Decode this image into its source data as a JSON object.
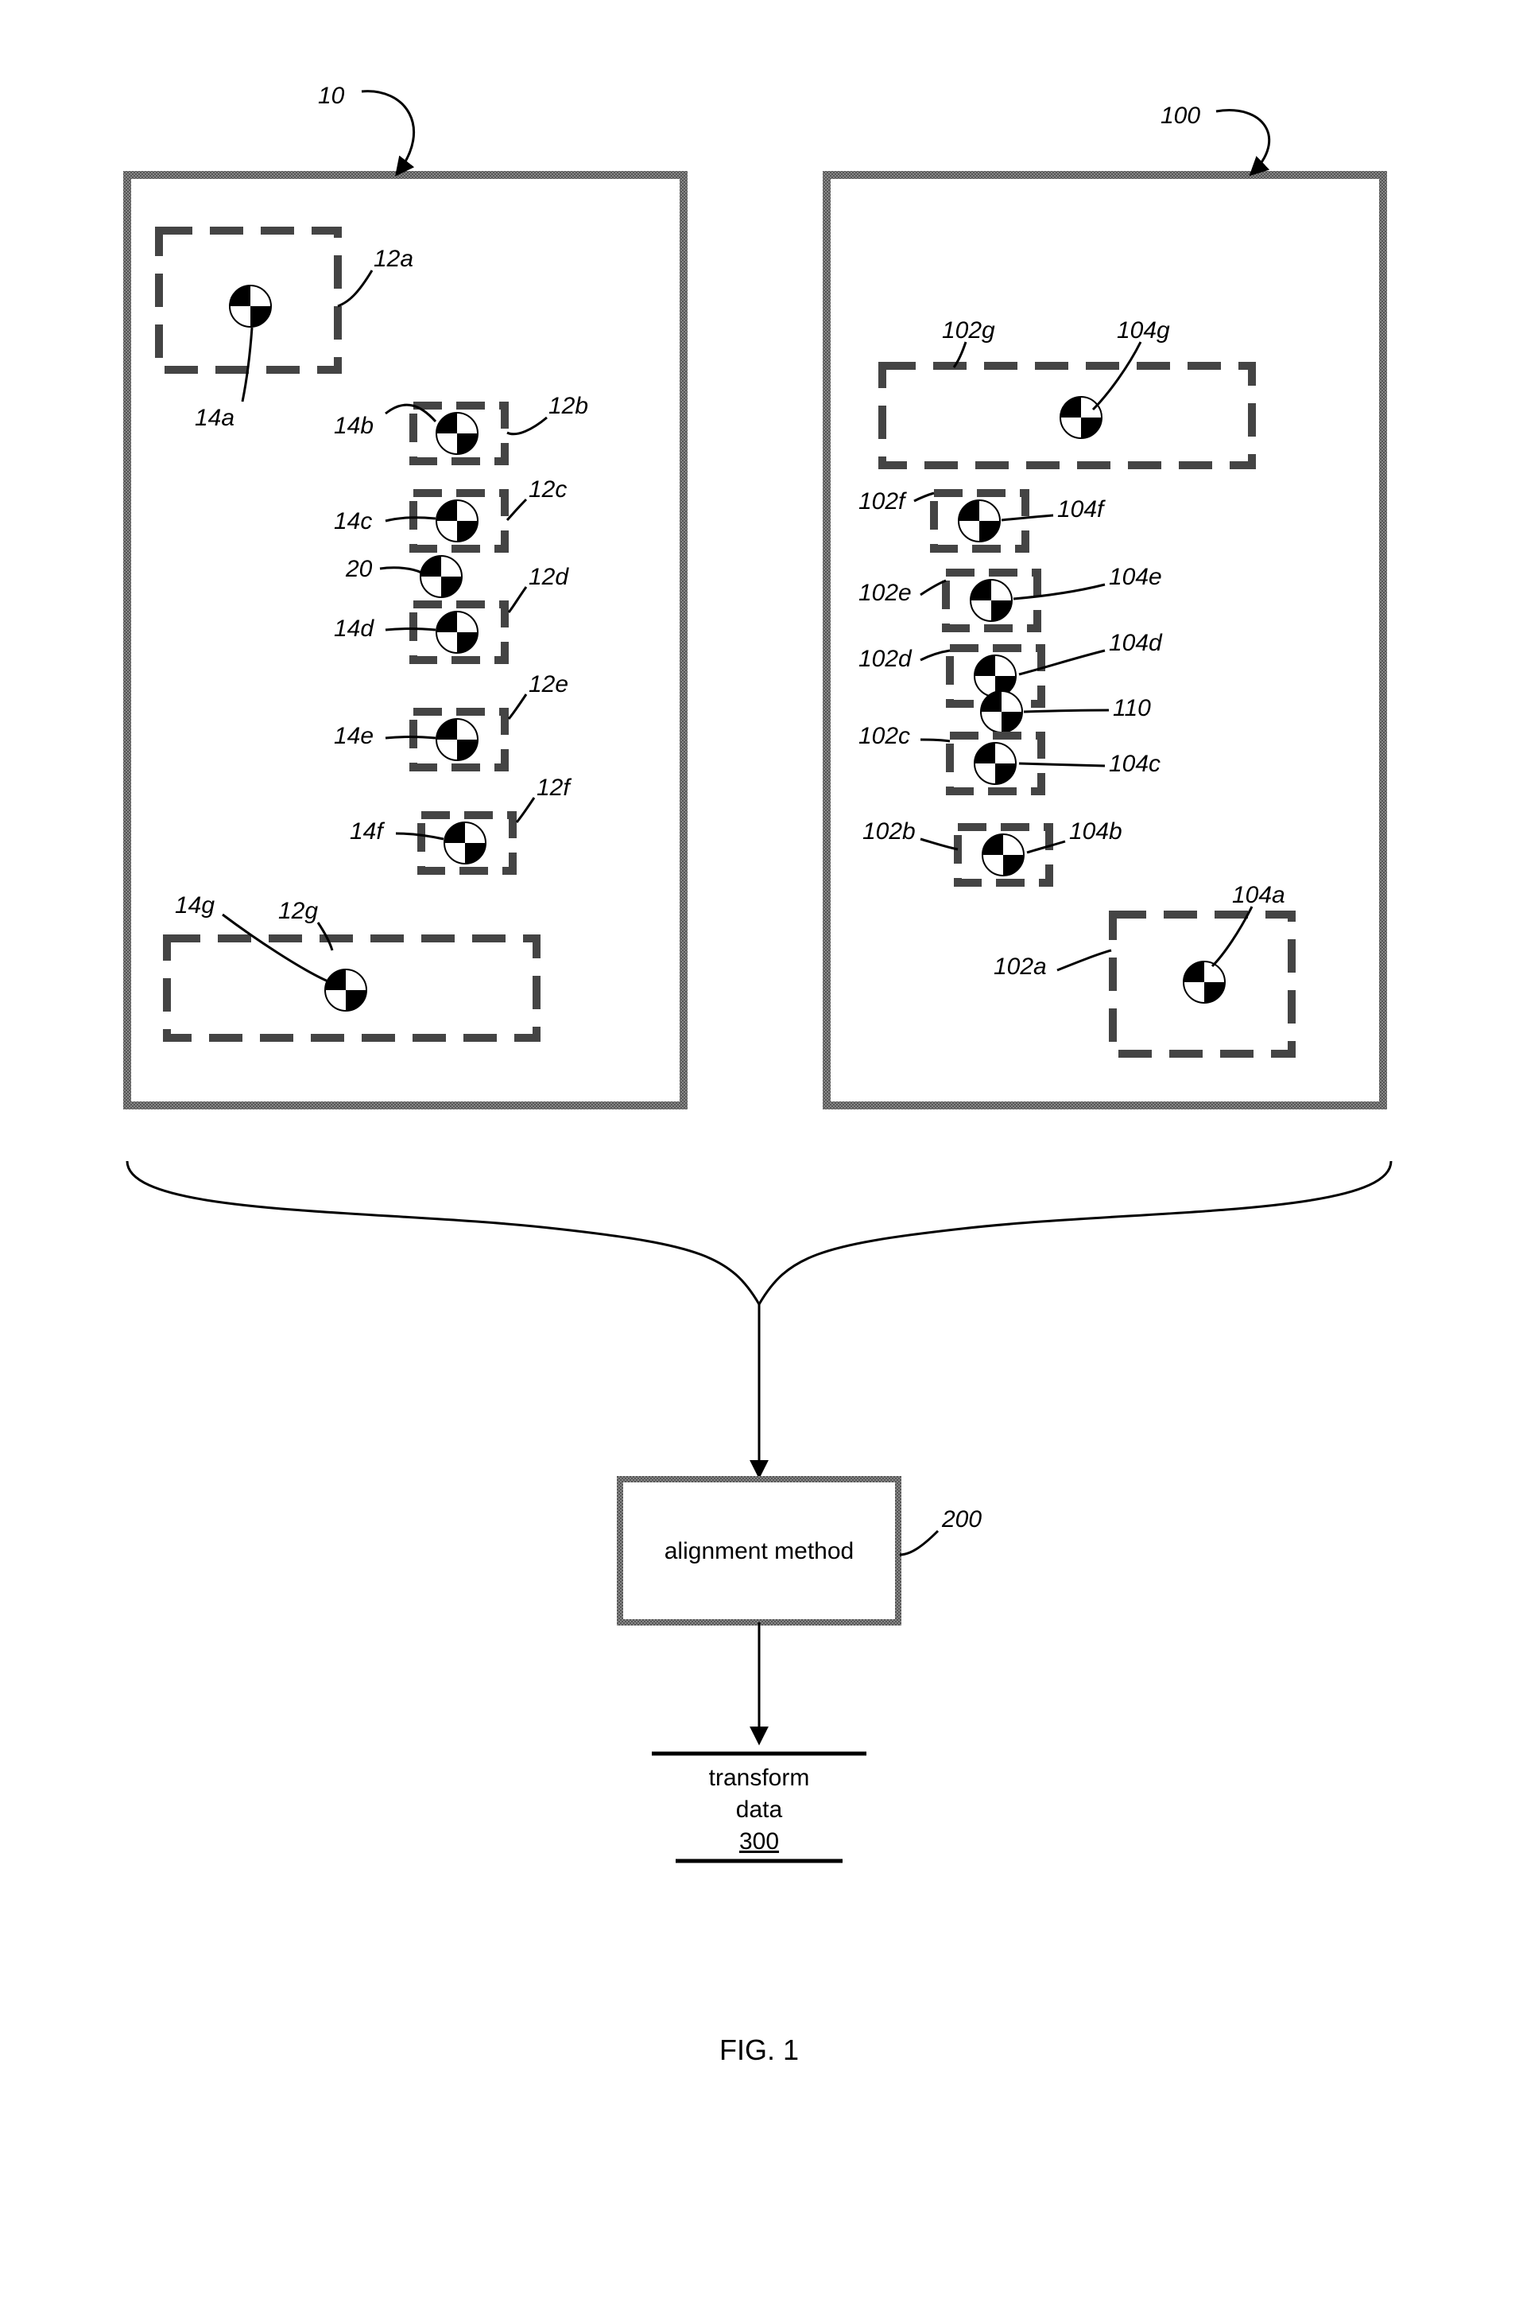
{
  "figure_label": "FIG. 1",
  "left": {
    "ref": "10",
    "boxes": {
      "a": "12a",
      "b": "12b",
      "c": "12c",
      "d": "12d",
      "e": "12e",
      "f": "12f",
      "g": "12g"
    },
    "marks": {
      "a": "14a",
      "b": "14b",
      "c": "14c",
      "d": "14d",
      "e": "14e",
      "f": "14f",
      "g": "14g"
    },
    "extra": "20"
  },
  "right": {
    "ref": "100",
    "boxes": {
      "a": "102a",
      "b": "102b",
      "c": "102c",
      "d": "102d",
      "e": "102e",
      "f": "102f",
      "g": "102g"
    },
    "marks": {
      "a": "104a",
      "b": "104b",
      "c": "104c",
      "d": "104d",
      "e": "104e",
      "f": "104f",
      "g": "104g"
    },
    "extra": "110"
  },
  "process": {
    "box_label": "alignment method",
    "box_ref": "200",
    "output_label1": "transform",
    "output_label2": "data",
    "output_ref": "300"
  }
}
